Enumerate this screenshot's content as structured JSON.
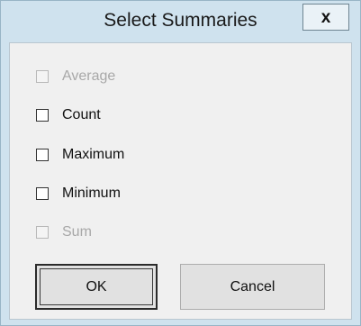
{
  "window": {
    "title": "Select Summaries",
    "close_label": "x"
  },
  "checkboxes": [
    {
      "label": "Average",
      "checked": false,
      "enabled": false
    },
    {
      "label": "Count",
      "checked": false,
      "enabled": true
    },
    {
      "label": "Maximum",
      "checked": false,
      "enabled": true
    },
    {
      "label": "Minimum",
      "checked": false,
      "enabled": true
    },
    {
      "label": "Sum",
      "checked": false,
      "enabled": false
    }
  ],
  "buttons": {
    "ok_label": "OK",
    "cancel_label": "Cancel"
  }
}
